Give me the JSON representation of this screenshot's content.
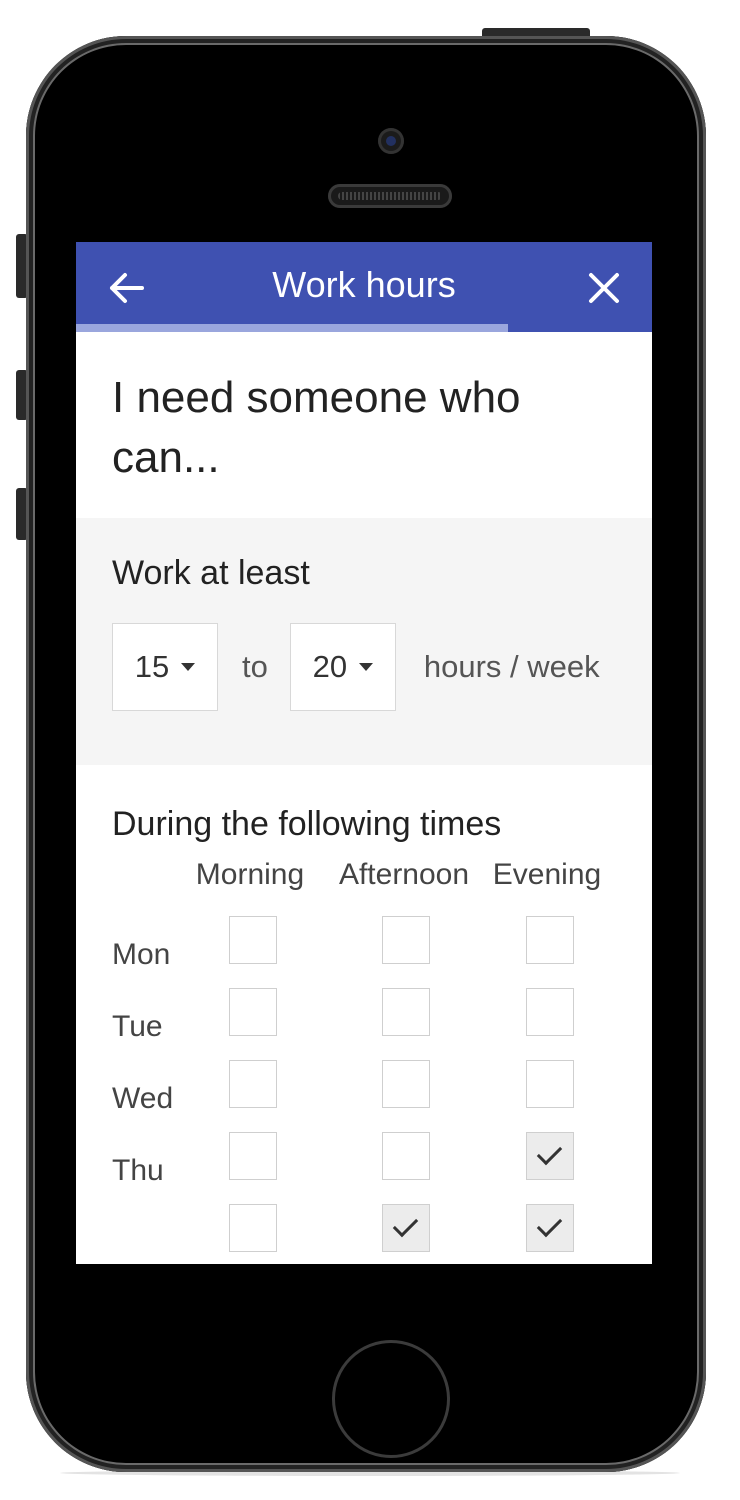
{
  "appbar": {
    "title": "Work hours",
    "back_icon": "arrow-left-icon",
    "close_icon": "close-icon",
    "accent": "#3f51b1",
    "progress_fraction": 0.75
  },
  "heading": "I need someone who can...",
  "hours": {
    "section_title": "Work at least",
    "min_value": "15",
    "to_label": "to",
    "max_value": "20",
    "unit_label": "hours / week"
  },
  "schedule": {
    "section_title": "During the following times",
    "columns": [
      "Morning",
      "Afternoon",
      "Evening"
    ],
    "rows": [
      {
        "day": "Mon",
        "checked": [
          false,
          false,
          false
        ]
      },
      {
        "day": "Tue",
        "checked": [
          false,
          false,
          false
        ]
      },
      {
        "day": "Wed",
        "checked": [
          false,
          false,
          false
        ]
      },
      {
        "day": "Thu",
        "checked": [
          false,
          false,
          true
        ]
      },
      {
        "day": "",
        "checked": [
          false,
          true,
          true
        ]
      }
    ]
  }
}
